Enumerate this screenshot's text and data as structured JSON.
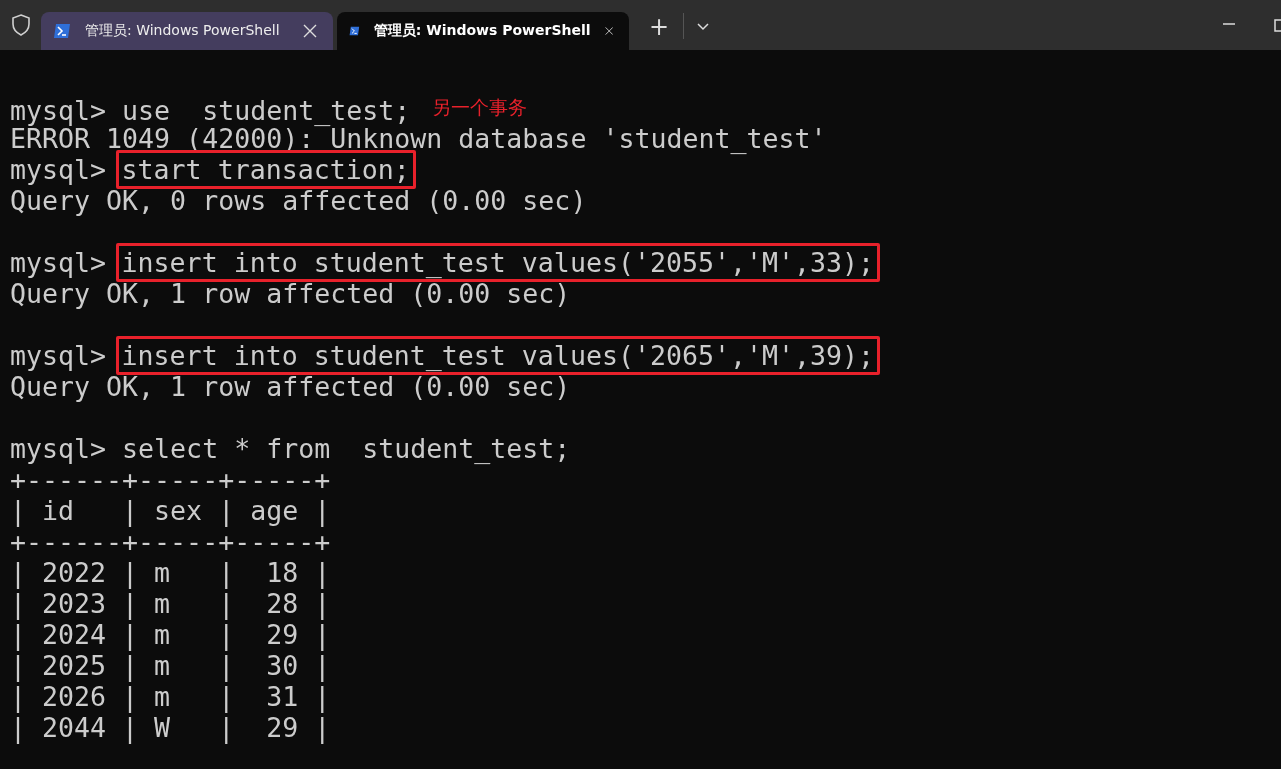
{
  "tabs": [
    {
      "title": "管理员: Windows PowerShell",
      "selected": false
    },
    {
      "title": "管理员: Windows PowerShell",
      "selected": true
    }
  ],
  "new_tab": "+",
  "lines": [
    {
      "kind": "command",
      "prompt": "mysql>",
      "command": "use  student_test;",
      "boxed": false,
      "note": "另一个事务"
    },
    {
      "kind": "output",
      "text": "ERROR 1049 (42000): Unknown database 'student_test'"
    },
    {
      "kind": "command",
      "prompt": "mysql>",
      "command": "start transaction;",
      "boxed": true
    },
    {
      "kind": "output",
      "text": "Query OK, 0 rows affected (0.00 sec)"
    },
    {
      "kind": "blank"
    },
    {
      "kind": "command",
      "prompt": "mysql>",
      "command": "insert into student_test values('2055','M',33);",
      "boxed": true
    },
    {
      "kind": "output",
      "text": "Query OK, 1 row affected (0.00 sec)"
    },
    {
      "kind": "blank"
    },
    {
      "kind": "command",
      "prompt": "mysql>",
      "command": "insert into student_test values('2065','M',39);",
      "boxed": true
    },
    {
      "kind": "output",
      "text": "Query OK, 1 row affected (0.00 sec)"
    },
    {
      "kind": "blank"
    },
    {
      "kind": "command",
      "prompt": "mysql>",
      "command": "select * from  student_test;",
      "boxed": false
    },
    {
      "kind": "output",
      "text": "+------+-----+-----+"
    },
    {
      "kind": "output",
      "text": "| id   | sex | age |"
    },
    {
      "kind": "output",
      "text": "+------+-----+-----+"
    },
    {
      "kind": "output",
      "text": "| 2022 | m   |  18 |"
    },
    {
      "kind": "output",
      "text": "| 2023 | m   |  28 |"
    },
    {
      "kind": "output",
      "text": "| 2024 | m   |  29 |"
    },
    {
      "kind": "output",
      "text": "| 2025 | m   |  30 |"
    },
    {
      "kind": "output",
      "text": "| 2026 | m   |  31 |"
    },
    {
      "kind": "output",
      "text": "| 2044 | W   |  29 |"
    }
  ]
}
